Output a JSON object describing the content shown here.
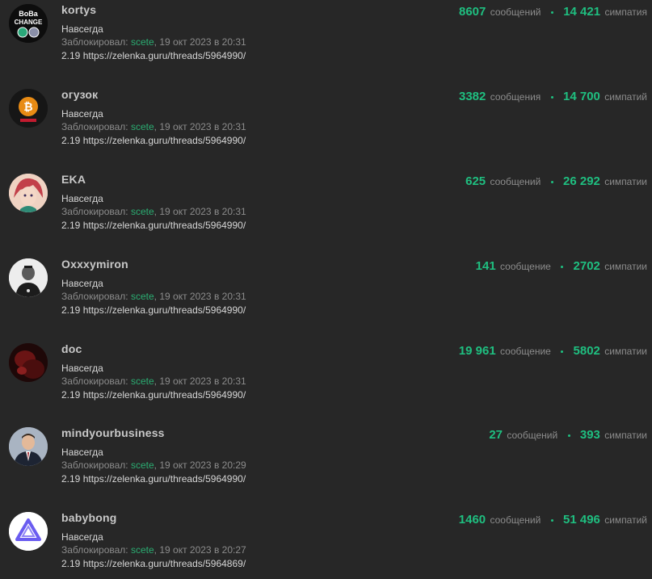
{
  "bans": [
    {
      "username": "kortys",
      "avatar": {
        "kind": "boba",
        "text1": "BoBa",
        "text2": "CHANGE",
        "bg": "#0d0d0d"
      },
      "duration": "Навсегда",
      "blocked_by_label": "Заблокировал:",
      "moderator": "scete",
      "date": "19 окт 2023 в 20:31",
      "reason": "2.19 https://zelenka.guru/threads/5964990/",
      "messages_count": "8607",
      "messages_label": "сообщений",
      "likes_count": "14 421",
      "likes_label": "симпатия"
    },
    {
      "username": "огузок",
      "avatar": {
        "kind": "bitcoin",
        "bg": "#1a1a1a"
      },
      "duration": "Навсегда",
      "blocked_by_label": "Заблокировал:",
      "moderator": "scete",
      "date": "19 окт 2023 в 20:31",
      "reason": "2.19 https://zelenka.guru/threads/5964990/",
      "messages_count": "3382",
      "messages_label": "сообщения",
      "likes_count": "14 700",
      "likes_label": "симпатий"
    },
    {
      "username": "EKA",
      "avatar": {
        "kind": "anime",
        "bg": "#e9c7b8"
      },
      "duration": "Навсегда",
      "blocked_by_label": "Заблокировал:",
      "moderator": "scete",
      "date": "19 окт 2023 в 20:31",
      "reason": "2.19 https://zelenka.guru/threads/5964990/",
      "messages_count": "625",
      "messages_label": "сообщений",
      "likes_count": "26 292",
      "likes_label": "симпатии"
    },
    {
      "username": "Oxxxymiron",
      "avatar": {
        "kind": "person-bw",
        "bg": "#e8e8e8"
      },
      "duration": "Навсегда",
      "blocked_by_label": "Заблокировал:",
      "moderator": "scete",
      "date": "19 окт 2023 в 20:31",
      "reason": "2.19 https://zelenka.guru/threads/5964990/",
      "messages_count": "141",
      "messages_label": "сообщение",
      "likes_count": "2702",
      "likes_label": "симпатии"
    },
    {
      "username": "doc",
      "avatar": {
        "kind": "dark-red",
        "bg": "#2a0c0c"
      },
      "duration": "Навсегда",
      "blocked_by_label": "Заблокировал:",
      "moderator": "scete",
      "date": "19 окт 2023 в 20:31",
      "reason": "2.19 https://zelenka.guru/threads/5964990/",
      "messages_count": "19 961",
      "messages_label": "сообщение",
      "likes_count": "5802",
      "likes_label": "симпатии"
    },
    {
      "username": "mindyourbusiness",
      "avatar": {
        "kind": "suit",
        "bg": "#9aa6b4"
      },
      "duration": "Навсегда",
      "blocked_by_label": "Заблокировал:",
      "moderator": "scete",
      "date": "19 окт 2023 в 20:29",
      "reason": "2.19 https://zelenka.guru/threads/5964990/",
      "messages_count": "27",
      "messages_label": "сообщений",
      "likes_count": "393",
      "likes_label": "симпатии"
    },
    {
      "username": "babybong",
      "avatar": {
        "kind": "logo",
        "bg": "#ffffff",
        "accent": "#6a5cf0"
      },
      "duration": "Навсегда",
      "blocked_by_label": "Заблокировал:",
      "moderator": "scete",
      "date": "19 окт 2023 в 20:27",
      "reason": "2.19 https://zelenka.guru/threads/5964869/",
      "messages_count": "1460",
      "messages_label": "сообщений",
      "likes_count": "51 496",
      "likes_label": "симпатий"
    }
  ],
  "colors": {
    "accent": "#1fbf80",
    "moderator": "#2bad72",
    "background": "#272727"
  }
}
